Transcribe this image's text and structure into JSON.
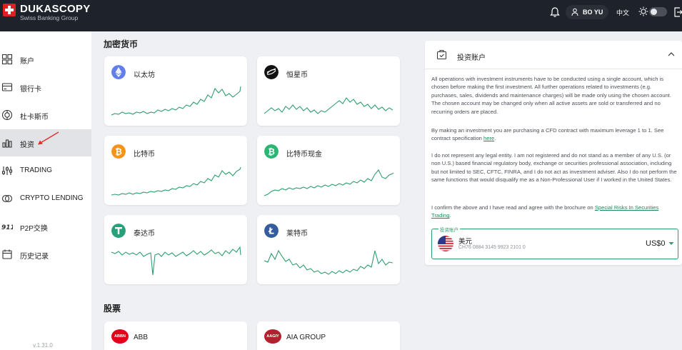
{
  "header": {
    "brand": "DUKASCOPY",
    "brand_sub": "Swiss Banking Group",
    "user_name": "BO YU",
    "language": "中文"
  },
  "sidebar": {
    "items": [
      {
        "label": "账户",
        "icon": "grid-icon"
      },
      {
        "label": "银行卡",
        "icon": "card-icon"
      },
      {
        "label": "杜卡斯币",
        "icon": "coin-icon"
      },
      {
        "label": "投资",
        "icon": "bar-chart-icon"
      },
      {
        "label": "TRADING",
        "icon": "sliders-icon"
      },
      {
        "label": "CRYPTO LENDING",
        "icon": "lending-icon"
      },
      {
        "label": "P2P交换",
        "icon": "p2p-icon"
      },
      {
        "label": "历史记录",
        "icon": "calendar-icon"
      }
    ],
    "active_index": 3,
    "version": "v.1.31.0"
  },
  "crypto": {
    "title": "加密货币",
    "cards": [
      {
        "name": "以太坊",
        "icon": "ethereum-icon",
        "color": "#627eea"
      },
      {
        "name": "恒星币",
        "icon": "stellar-icon",
        "color": "#111111"
      },
      {
        "name": "比特币",
        "icon": "bitcoin-icon",
        "color": "#f7931a"
      },
      {
        "name": "比特币现金",
        "icon": "bitcoin-cash-icon",
        "color": "#2bb673"
      },
      {
        "name": "泰达币",
        "icon": "tether-icon",
        "color": "#26a17b"
      },
      {
        "name": "莱特币",
        "icon": "litecoin-icon",
        "color": "#345d9d"
      }
    ]
  },
  "stocks": {
    "title": "股票",
    "cards": [
      {
        "name": "ABB",
        "logo_text": "ABBN",
        "color": "#e2001a"
      },
      {
        "name": "AIA GROUP",
        "logo_text": "AAGIY",
        "color": "#b2212e"
      }
    ]
  },
  "panel": {
    "title": "投资账户",
    "para1": "All operations with investment instruments have to be conducted using a single account, which is chosen before making the first investment. All further operations related to investments (e.g. purchases, sales, dividends and maintenance charges) will be made only using the chosen account. The chosen account may be changed only when all active assets are sold or transferred and no recurring orders are placed.",
    "para2_pre": "By making an investment you are purchasing a CFD contract with maximum leverage 1 to 1. See contract specification ",
    "para2_link": "here",
    "para2_post": ".",
    "para3": "I do not represent any legal entity. I am not registered and do not stand as a member of any U.S. (or non U.S.) based financial regulatory body, exchange or securities professional association, including but not limited to SEC, CFTC, FINRA, and I do not act as investment adviser. Also I do not perform the same functions that would disqualify me as a Non-Professional User if I worked in the United States.",
    "para4_pre": "I confirm the above and I have read and agree with the brochure on ",
    "para4_link": "Special Risks In Securities Trading",
    "para4_post": ".",
    "account": {
      "legend": "投资账户",
      "currency": "美元",
      "iban": "CH76 0884 3145 9923 2101 0",
      "amount": "US$0"
    },
    "accent_color": "#2a9d6a"
  }
}
